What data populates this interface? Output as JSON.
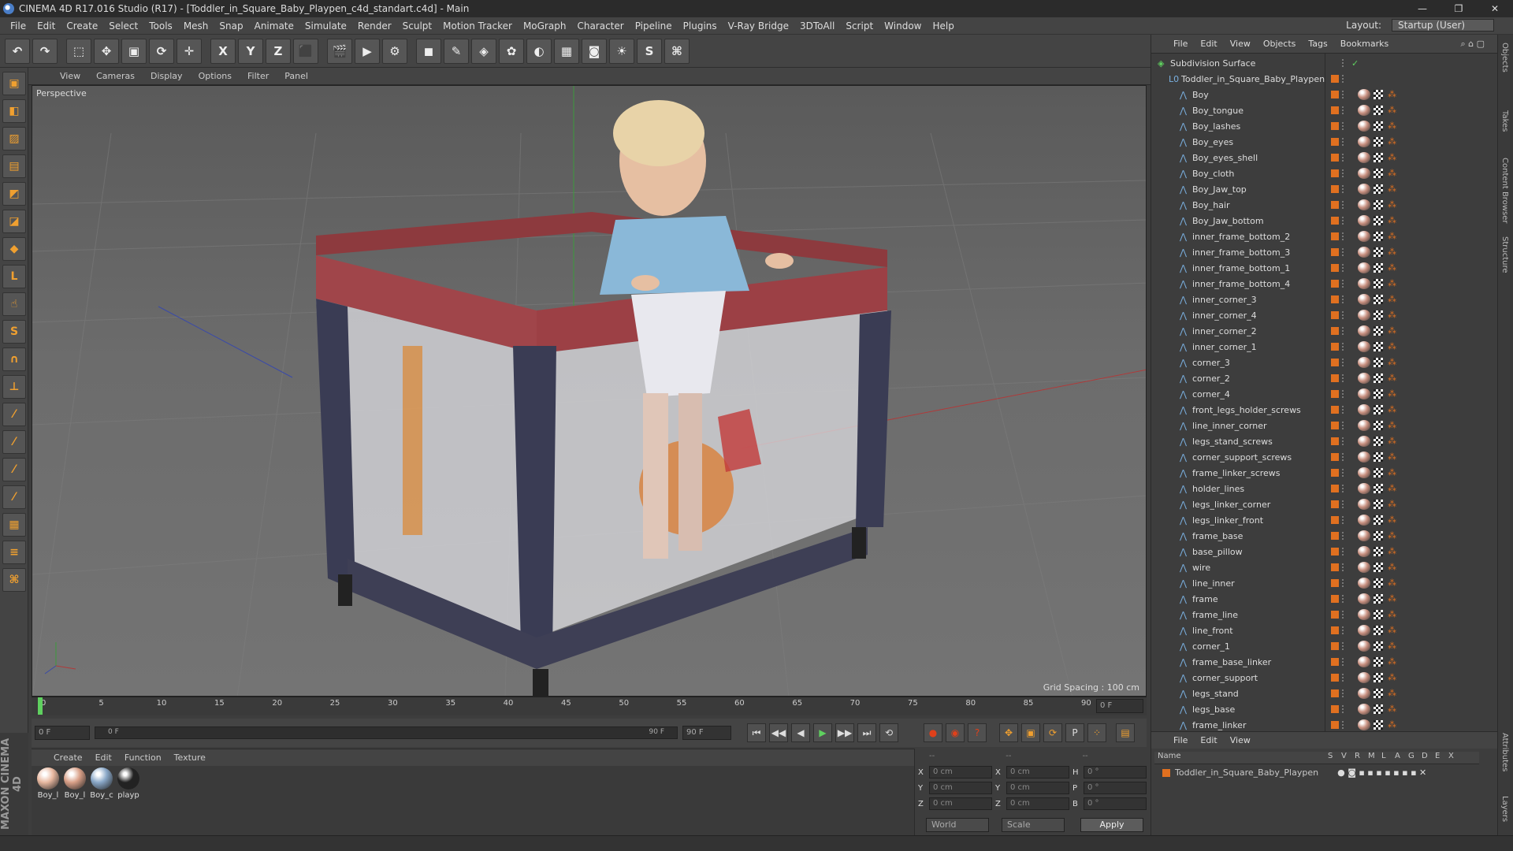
{
  "window": {
    "title": "CINEMA 4D R17.016 Studio (R17) - [Toddler_in_Square_Baby_Playpen_c4d_standart.c4d] - Main",
    "controls": [
      "—",
      "❐",
      "✕"
    ]
  },
  "menubar": {
    "items": [
      "File",
      "Edit",
      "Create",
      "Select",
      "Tools",
      "Mesh",
      "Snap",
      "Animate",
      "Simulate",
      "Render",
      "Sculpt",
      "Motion Tracker",
      "MoGraph",
      "Character",
      "Pipeline",
      "Plugins",
      "V-Ray Bridge",
      "3DToAll",
      "Script",
      "Window",
      "Help"
    ],
    "layout_label": "Layout:",
    "layout_value": "Startup (User)"
  },
  "toolbar": {
    "buttons": [
      {
        "name": "undo-icon",
        "glyph": "↶"
      },
      {
        "name": "redo-icon",
        "glyph": "↷"
      },
      {
        "name": "live-selection-icon",
        "glyph": "⬚"
      },
      {
        "name": "move-icon",
        "glyph": "✥"
      },
      {
        "name": "scale-icon",
        "glyph": "▣"
      },
      {
        "name": "rotate-icon",
        "glyph": "⟳"
      },
      {
        "name": "transform-icon",
        "glyph": "✛"
      },
      {
        "name": "x-axis-icon",
        "glyph": "X"
      },
      {
        "name": "y-axis-icon",
        "glyph": "Y"
      },
      {
        "name": "z-axis-icon",
        "glyph": "Z"
      },
      {
        "name": "coordinate-system-icon",
        "glyph": "⬛"
      },
      {
        "name": "render-view-icon",
        "glyph": "🎬"
      },
      {
        "name": "render-picture-viewer-icon",
        "glyph": "▶"
      },
      {
        "name": "edit-render-settings-icon",
        "glyph": "⚙"
      },
      {
        "name": "cube-icon",
        "glyph": "◼"
      },
      {
        "name": "pen-spline-icon",
        "glyph": "✎"
      },
      {
        "name": "subdivision-icon",
        "glyph": "◈"
      },
      {
        "name": "array-icon",
        "glyph": "✿"
      },
      {
        "name": "deformer-icon",
        "glyph": "◐"
      },
      {
        "name": "floor-icon",
        "glyph": "▦"
      },
      {
        "name": "camera-icon",
        "glyph": "◙"
      },
      {
        "name": "light-icon",
        "glyph": "☀"
      },
      {
        "name": "vray-icon",
        "glyph": "S"
      },
      {
        "name": "python-icon",
        "glyph": "⌘"
      }
    ]
  },
  "lefttools": [
    {
      "name": "make-editable-icon",
      "glyph": "▣"
    },
    {
      "name": "model-mode-icon",
      "glyph": "◧"
    },
    {
      "name": "texture-mode-icon",
      "glyph": "▨"
    },
    {
      "name": "workplane-icon",
      "glyph": "▤"
    },
    {
      "name": "points-mode-icon",
      "glyph": "◩"
    },
    {
      "name": "edges-mode-icon",
      "glyph": "◪"
    },
    {
      "name": "polygons-mode-icon",
      "glyph": "◆"
    },
    {
      "name": "axis-mode-icon",
      "glyph": "L"
    },
    {
      "name": "tweak-icon",
      "glyph": "☝"
    },
    {
      "name": "snap-icon",
      "glyph": "S"
    },
    {
      "name": "magnet-icon",
      "glyph": "∩"
    },
    {
      "name": "joint-icon",
      "glyph": "⊥"
    },
    {
      "name": "brush-icon",
      "glyph": "⁄"
    },
    {
      "name": "sculpt-icon",
      "glyph": "⁄"
    },
    {
      "name": "paint-icon",
      "glyph": "⁄"
    },
    {
      "name": "hair-icon",
      "glyph": "⁄"
    },
    {
      "name": "grid-lock-icon",
      "glyph": "▦"
    },
    {
      "name": "stack-icon",
      "glyph": "≡"
    },
    {
      "name": "python-script-icon",
      "glyph": "⌘"
    }
  ],
  "viewport": {
    "menu": [
      "View",
      "Cameras",
      "Display",
      "Options",
      "Filter",
      "Panel"
    ],
    "label": "Perspective",
    "grid_spacing": "Grid Spacing : 100 cm"
  },
  "timeline": {
    "ticks": [
      "0",
      "5",
      "10",
      "15",
      "20",
      "25",
      "30",
      "35",
      "40",
      "45",
      "50",
      "55",
      "60",
      "65",
      "70",
      "75",
      "80",
      "85",
      "90"
    ],
    "current_frame_right": "0 F"
  },
  "playbar": {
    "start": "0 F",
    "range_start": "0 F",
    "range_end": "90 F",
    "end": "90 F",
    "buttons": [
      "⏮",
      "◀◀",
      "◀",
      "▶",
      "▶▶",
      "⏭",
      "⟲"
    ]
  },
  "materials": {
    "menu": [
      "Create",
      "Edit",
      "Function",
      "Texture"
    ],
    "items": [
      {
        "label": "Boy_l",
        "color": "#e8b8a0"
      },
      {
        "label": "Boy_l",
        "color": "#d9a088"
      },
      {
        "label": "Boy_c",
        "color": "#8aa8c8"
      },
      {
        "label": "playp",
        "color": "#222222"
      }
    ]
  },
  "coords": {
    "header_dashes": [
      "--",
      "--",
      "--"
    ],
    "rows": [
      {
        "a": "X",
        "av": "0 cm",
        "b": "X",
        "bv": "0 cm",
        "c": "H",
        "cv": "0 °"
      },
      {
        "a": "Y",
        "av": "0 cm",
        "b": "Y",
        "bv": "0 cm",
        "c": "P",
        "cv": "0 °"
      },
      {
        "a": "Z",
        "av": "0 cm",
        "b": "Z",
        "bv": "0 cm",
        "c": "B",
        "cv": "0 °"
      }
    ],
    "world": "World",
    "scale": "Scale",
    "apply": "Apply"
  },
  "objects": {
    "menu": [
      "File",
      "Edit",
      "View",
      "Objects",
      "Tags",
      "Bookmarks"
    ],
    "root": "Subdivision Surface",
    "group": "Toddler_in_Square_Baby_Playpen",
    "items": [
      "Boy",
      "Boy_tongue",
      "Boy_lashes",
      "Boy_eyes",
      "Boy_eyes_shell",
      "Boy_cloth",
      "Boy_Jaw_top",
      "Boy_hair",
      "Boy_Jaw_bottom",
      "inner_frame_bottom_2",
      "inner_frame_bottom_3",
      "inner_frame_bottom_1",
      "inner_frame_bottom_4",
      "inner_corner_3",
      "inner_corner_4",
      "inner_corner_2",
      "inner_corner_1",
      "corner_3",
      "corner_2",
      "corner_4",
      "front_legs_holder_screws",
      "line_inner_corner",
      "legs_stand_screws",
      "corner_support_screws",
      "frame_linker_screws",
      "holder_lines",
      "legs_linker_corner",
      "legs_linker_front",
      "frame_base",
      "base_pillow",
      "wire",
      "line_inner",
      "frame",
      "frame_line",
      "line_front",
      "corner_1",
      "frame_base_linker",
      "corner_support",
      "legs_stand",
      "legs_base",
      "frame_linker"
    ]
  },
  "layers": {
    "menu": [
      "File",
      "Edit",
      "View"
    ],
    "columns": [
      "Name",
      "S",
      "V",
      "R",
      "M",
      "L",
      "A",
      "G",
      "D",
      "E",
      "X"
    ],
    "row": "Toddler_in_Square_Baby_Playpen"
  },
  "sidetabs": [
    "Objects",
    "Takes",
    "Content Browser",
    "Structure",
    "Attributes",
    "Layers"
  ],
  "branding": "MAXON CINEMA 4D"
}
